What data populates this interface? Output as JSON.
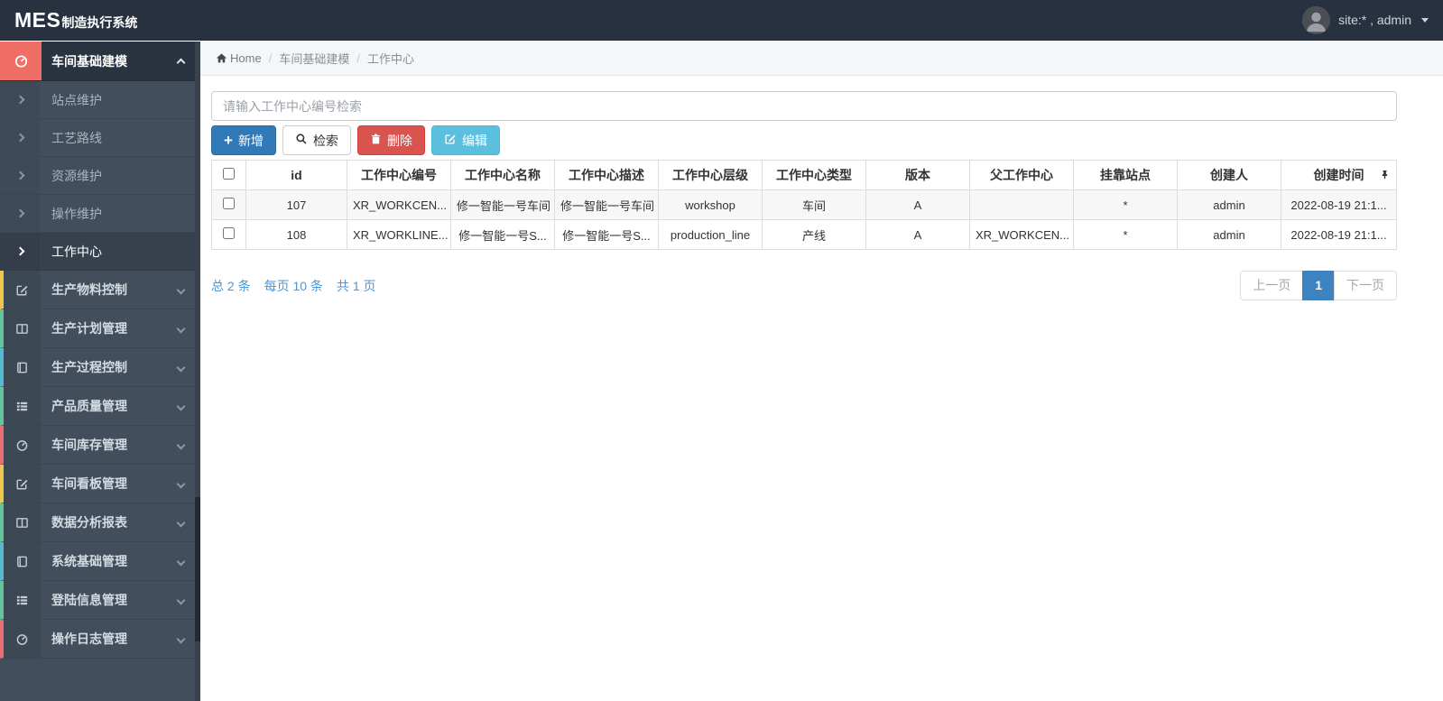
{
  "navbar": {
    "brand_primary": "MES",
    "brand_secondary": "制造执行系统",
    "user_label": "site:* , admin"
  },
  "breadcrumb": {
    "home_label": "Home",
    "separator": "/",
    "level1": "车间基础建模",
    "level2": "工作中心"
  },
  "sidebar": {
    "active_group": {
      "label": "车间基础建模",
      "icon": "dashboard-icon"
    },
    "sub_items": [
      {
        "label": "站点维护",
        "active": false
      },
      {
        "label": "工艺路线",
        "active": false
      },
      {
        "label": "资源维护",
        "active": false
      },
      {
        "label": "操作维护",
        "active": false
      },
      {
        "label": "工作中心",
        "active": true
      }
    ],
    "groups": [
      {
        "label": "生产物料控制",
        "icon": "edit-icon",
        "accent": "#edc64d"
      },
      {
        "label": "生产计划管理",
        "icon": "columns-icon",
        "accent": "#67c39b"
      },
      {
        "label": "生产过程控制",
        "icon": "book-icon",
        "accent": "#54b9d1"
      },
      {
        "label": "产品质量管理",
        "icon": "list-icon",
        "accent": "#67c39b"
      },
      {
        "label": "车间库存管理",
        "icon": "dashboard-icon",
        "accent": "#e76c74"
      },
      {
        "label": "车间看板管理",
        "icon": "edit-icon",
        "accent": "#edc64d"
      },
      {
        "label": "数据分析报表",
        "icon": "columns-icon",
        "accent": "#67c39b"
      },
      {
        "label": "系统基础管理",
        "icon": "book-icon",
        "accent": "#54b9d1"
      },
      {
        "label": "登陆信息管理",
        "icon": "list-icon",
        "accent": "#67c39b"
      },
      {
        "label": "操作日志管理",
        "icon": "dashboard-icon",
        "accent": "#e76c74"
      }
    ]
  },
  "toolbar": {
    "search_placeholder": "请输入工作中心编号检索",
    "add_label": "新增",
    "search_label": "检索",
    "delete_label": "删除",
    "edit_label": "编辑"
  },
  "table": {
    "columns": [
      "id",
      "工作中心编号",
      "工作中心名称",
      "工作中心描述",
      "工作中心层级",
      "工作中心类型",
      "版本",
      "父工作中心",
      "挂靠站点",
      "创建人",
      "创建时间"
    ],
    "rows": [
      {
        "id": "107",
        "code": "XR_WORKCEN...",
        "name": "修一智能一号车间",
        "desc": "修一智能一号车间",
        "level": "workshop",
        "type": "车间",
        "version": "A",
        "parent": "",
        "station": "*",
        "creator": "admin",
        "created": "2022-08-19 21:1..."
      },
      {
        "id": "108",
        "code": "XR_WORKLINE...",
        "name": "修一智能一号S...",
        "desc": "修一智能一号S...",
        "level": "production_line",
        "type": "产线",
        "version": "A",
        "parent": "XR_WORKCEN...",
        "station": "*",
        "creator": "admin",
        "created": "2022-08-19 21:1..."
      }
    ]
  },
  "pager": {
    "total_label": "总 2 条",
    "per_page_label": "每页 10 条",
    "page_count_label": "共 1 页",
    "prev_label": "上一页",
    "current_page": "1",
    "next_label": "下一页"
  },
  "colors": {
    "navbar_bg": "#27313f",
    "sidebar_bg": "#424e5c",
    "active_group_bg": "#2a3441",
    "active_icon_bg": "#ef6e66",
    "primary_blue": "#3279b7",
    "danger_red": "#d9534f",
    "info_cyan": "#5bc0de",
    "link_blue": "#4c95d9",
    "pagination_active": "#3c83c0"
  }
}
